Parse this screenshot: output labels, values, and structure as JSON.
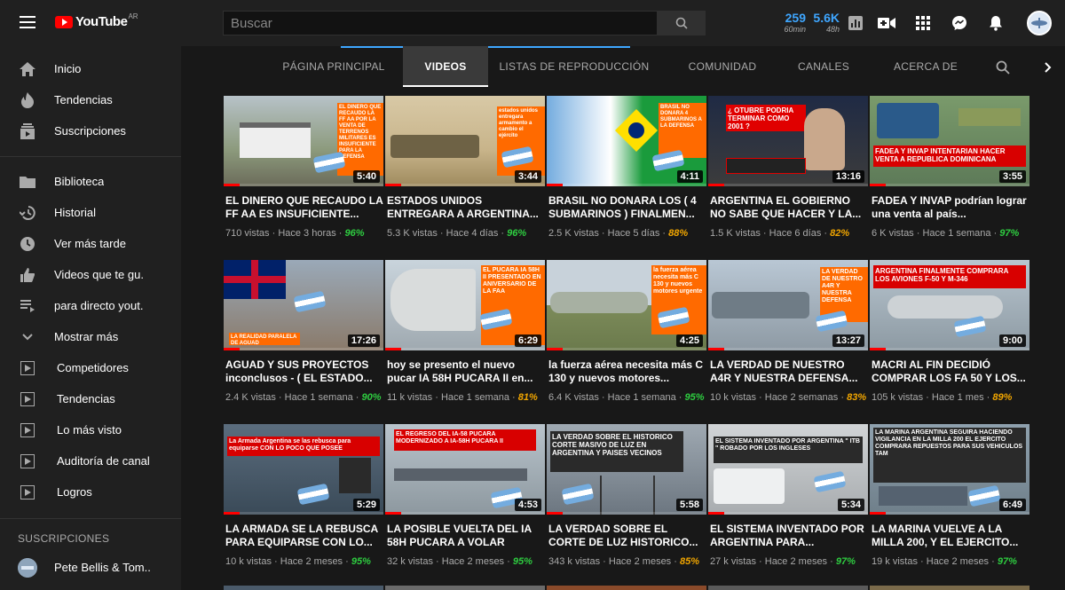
{
  "app": {
    "logo_text": "YouTube",
    "logo_country": "AR"
  },
  "search": {
    "placeholder": "Buscar"
  },
  "stats": [
    {
      "value": "259",
      "label": "60min"
    },
    {
      "value": "5.6K",
      "label": "48h"
    }
  ],
  "sidebar": {
    "items": [
      {
        "label": "Inicio",
        "icon": "home-icon"
      },
      {
        "label": "Tendencias",
        "icon": "fire-icon"
      },
      {
        "label": "Suscripciones",
        "icon": "subscriptions-icon"
      },
      {
        "label": "Biblioteca",
        "icon": "folder-icon"
      },
      {
        "label": "Historial",
        "icon": "history-icon"
      },
      {
        "label": "Ver más tarde",
        "icon": "clock-icon"
      },
      {
        "label": "Videos que te gu...",
        "icon": "thumbs-up-icon"
      },
      {
        "label": "para directo yout...",
        "icon": "playlist-icon"
      },
      {
        "label": "Mostrar más",
        "icon": "chevron-down-icon"
      },
      {
        "label": "Competidores",
        "icon": "playlist-play-icon"
      },
      {
        "label": "Tendencias",
        "icon": "playlist-play-icon"
      },
      {
        "label": "Lo más visto",
        "icon": "playlist-play-icon"
      },
      {
        "label": "Auditoría de canal",
        "icon": "playlist-play-icon"
      },
      {
        "label": "Logros",
        "icon": "playlist-play-icon"
      }
    ],
    "subscriptions_header": "SUSCRIPCIONES",
    "subscription": {
      "label": "Pete Bellis & Tom..."
    }
  },
  "tabs": [
    {
      "label": "PÁGINA PRINCIPAL"
    },
    {
      "label": "VIDEOS"
    },
    {
      "label": "LISTAS DE REPRODUCCIÓN"
    },
    {
      "label": "COMUNIDAD"
    },
    {
      "label": "CANALES"
    },
    {
      "label": "ACERCA DE"
    }
  ],
  "colors": {
    "accent": "#3ea6ff",
    "high": "#2ecc40",
    "mid": "#f0a500",
    "bg": "#181818",
    "panel": "#202020"
  },
  "videos": [
    {
      "title": "EL DINERO QUE RECAUDO LA FF AA ES INSUFICIENTE...",
      "views": "710 vistas",
      "time": "Hace 3 horas",
      "pct": "96%",
      "dur": "5:40",
      "tone": "high",
      "thumb_text": "EL DINERO QUE RECAUDO LA FF AA POR LA VENTA DE TERRENOS MILITARES ES INSUFICIENTE PARA LA DEFENSA"
    },
    {
      "title": "ESTADOS UNIDOS ENTREGARA A ARGENTINA...",
      "views": "5.3 K vistas",
      "time": "Hace 4 días",
      "pct": "96%",
      "dur": "3:44",
      "tone": "high",
      "thumb_text": "estados unidos entregara armamento a cambio el ejército"
    },
    {
      "title": "BRASIL NO DONARA LOS ( 4 SUBMARINOS ) FINALMEN...",
      "views": "2.5 K vistas",
      "time": "Hace 5 días",
      "pct": "88%",
      "dur": "4:11",
      "tone": "mid",
      "thumb_text": "BRASIL NO DONARA 4 SUBMARINOS A LA DEFENSA"
    },
    {
      "title": "ARGENTINA EL GOBIERNO NO SABE QUE HACER Y LA...",
      "views": "1.5 K vistas",
      "time": "Hace 6 días",
      "pct": "82%",
      "dur": "13:16",
      "tone": "mid",
      "thumb_text": "¿ OTUBRE PODRIA TERMINAR COMO 2001 ?"
    },
    {
      "title": "FADEA Y INVAP podrían lograr una venta al país...",
      "views": "6 K vistas",
      "time": "Hace 1 semana",
      "pct": "97%",
      "dur": "3:55",
      "tone": "high",
      "thumb_text": "FADEA Y INVAP INTENTARIAN HACER VENTA A REPUBLICA DOMINICANA"
    },
    {
      "title": "AGUAD Y SUS PROYECTOS inconclusos - ( EL ESTADO...",
      "views": "2.4 K vistas",
      "time": "Hace 1 semana",
      "pct": "90%",
      "dur": "17:26",
      "tone": "high",
      "thumb_text": "LA REALIDAD PARALELA DE AGUAD"
    },
    {
      "title": "hoy se presento el nuevo pucar IA 58H PUCARA II en...",
      "views": "11 k vistas",
      "time": "Hace 1 semana",
      "pct": "81%",
      "dur": "6:29",
      "tone": "mid",
      "thumb_text": "EL PUCARA IA 58H II PRESENTADO EN ANIVERSARIO DE LA FAA"
    },
    {
      "title": "la fuerza aérea necesita más C 130 y nuevos motores...",
      "views": "6.4 K vistas",
      "time": "Hace 1 semana",
      "pct": "95%",
      "dur": "4:25",
      "tone": "high",
      "thumb_text": "la fuerza aérea necesita más C 130 y nuevos motores urgente"
    },
    {
      "title": "LA VERDAD DE NUESTRO A4R Y NUESTRA DEFENSA...",
      "views": "10 k vistas",
      "time": "Hace 2 semanas",
      "pct": "83%",
      "dur": "13:27",
      "tone": "mid",
      "thumb_text": "LA VERDAD DE NUESTRO A4R Y NUESTRA DEFENSA"
    },
    {
      "title": "MACRI AL FIN DECIDIÓ COMPRAR LOS FA 50 Y LOS...",
      "views": "105 k vistas",
      "time": "Hace 1 mes",
      "pct": "89%",
      "dur": "9:00",
      "tone": "mid",
      "thumb_text": "ARGENTINA FINALMENTE COMPRARA LOS AVIONES F-50 Y M-346"
    },
    {
      "title": "LA ARMADA SE LA REBUSCA PARA EQUIPARSE CON LO...",
      "views": "10 k vistas",
      "time": "Hace 2 meses",
      "pct": "95%",
      "dur": "5:29",
      "tone": "high",
      "thumb_text": "La Armada Argentina se las rebusca para equiparse CON LO POCO QUE POSEE"
    },
    {
      "title": "LA POSIBLE VUELTA DEL IA 58H PUCARA A VOLAR",
      "views": "32 k vistas",
      "time": "Hace 2 meses",
      "pct": "95%",
      "dur": "4:53",
      "tone": "high",
      "thumb_text": "EL REGRESO DEL IA-58 PUCARA MODERNIZADO A IA-58H PUCARA II"
    },
    {
      "title": "LA VERDAD SOBRE EL CORTE DE LUZ HISTORICO...",
      "views": "343 k vistas",
      "time": "Hace 2 meses",
      "pct": "85%",
      "dur": "5:58",
      "tone": "mid",
      "thumb_text": "LA VERDAD SOBRE EL HISTORICO CORTE MASIVO DE LUZ EN ARGENTINA Y PAISES VECINOS"
    },
    {
      "title": "EL SISTEMA INVENTADO POR ARGENTINA PARA...",
      "views": "27 k vistas",
      "time": "Hace 2 meses",
      "pct": "97%",
      "dur": "5:34",
      "tone": "high",
      "thumb_text": "EL SISTEMA INVENTADO POR ARGENTINA \" ITB \" ROBADO POR LOS INGLESES"
    },
    {
      "title": "LA MARINA VUELVE A LA MILLA 200, Y EL EJERCITO...",
      "views": "19 k vistas",
      "time": "Hace 2 meses",
      "pct": "97%",
      "dur": "6:49",
      "tone": "high",
      "thumb_text": "LA MARINA ARGENTINA SEGUIRA HACIENDO VIGILANCIA EN LA MILLA 200 EL EJERCITO COMPRARA REPUESTOS PARA SUS VEHICULOS TAM"
    }
  ]
}
